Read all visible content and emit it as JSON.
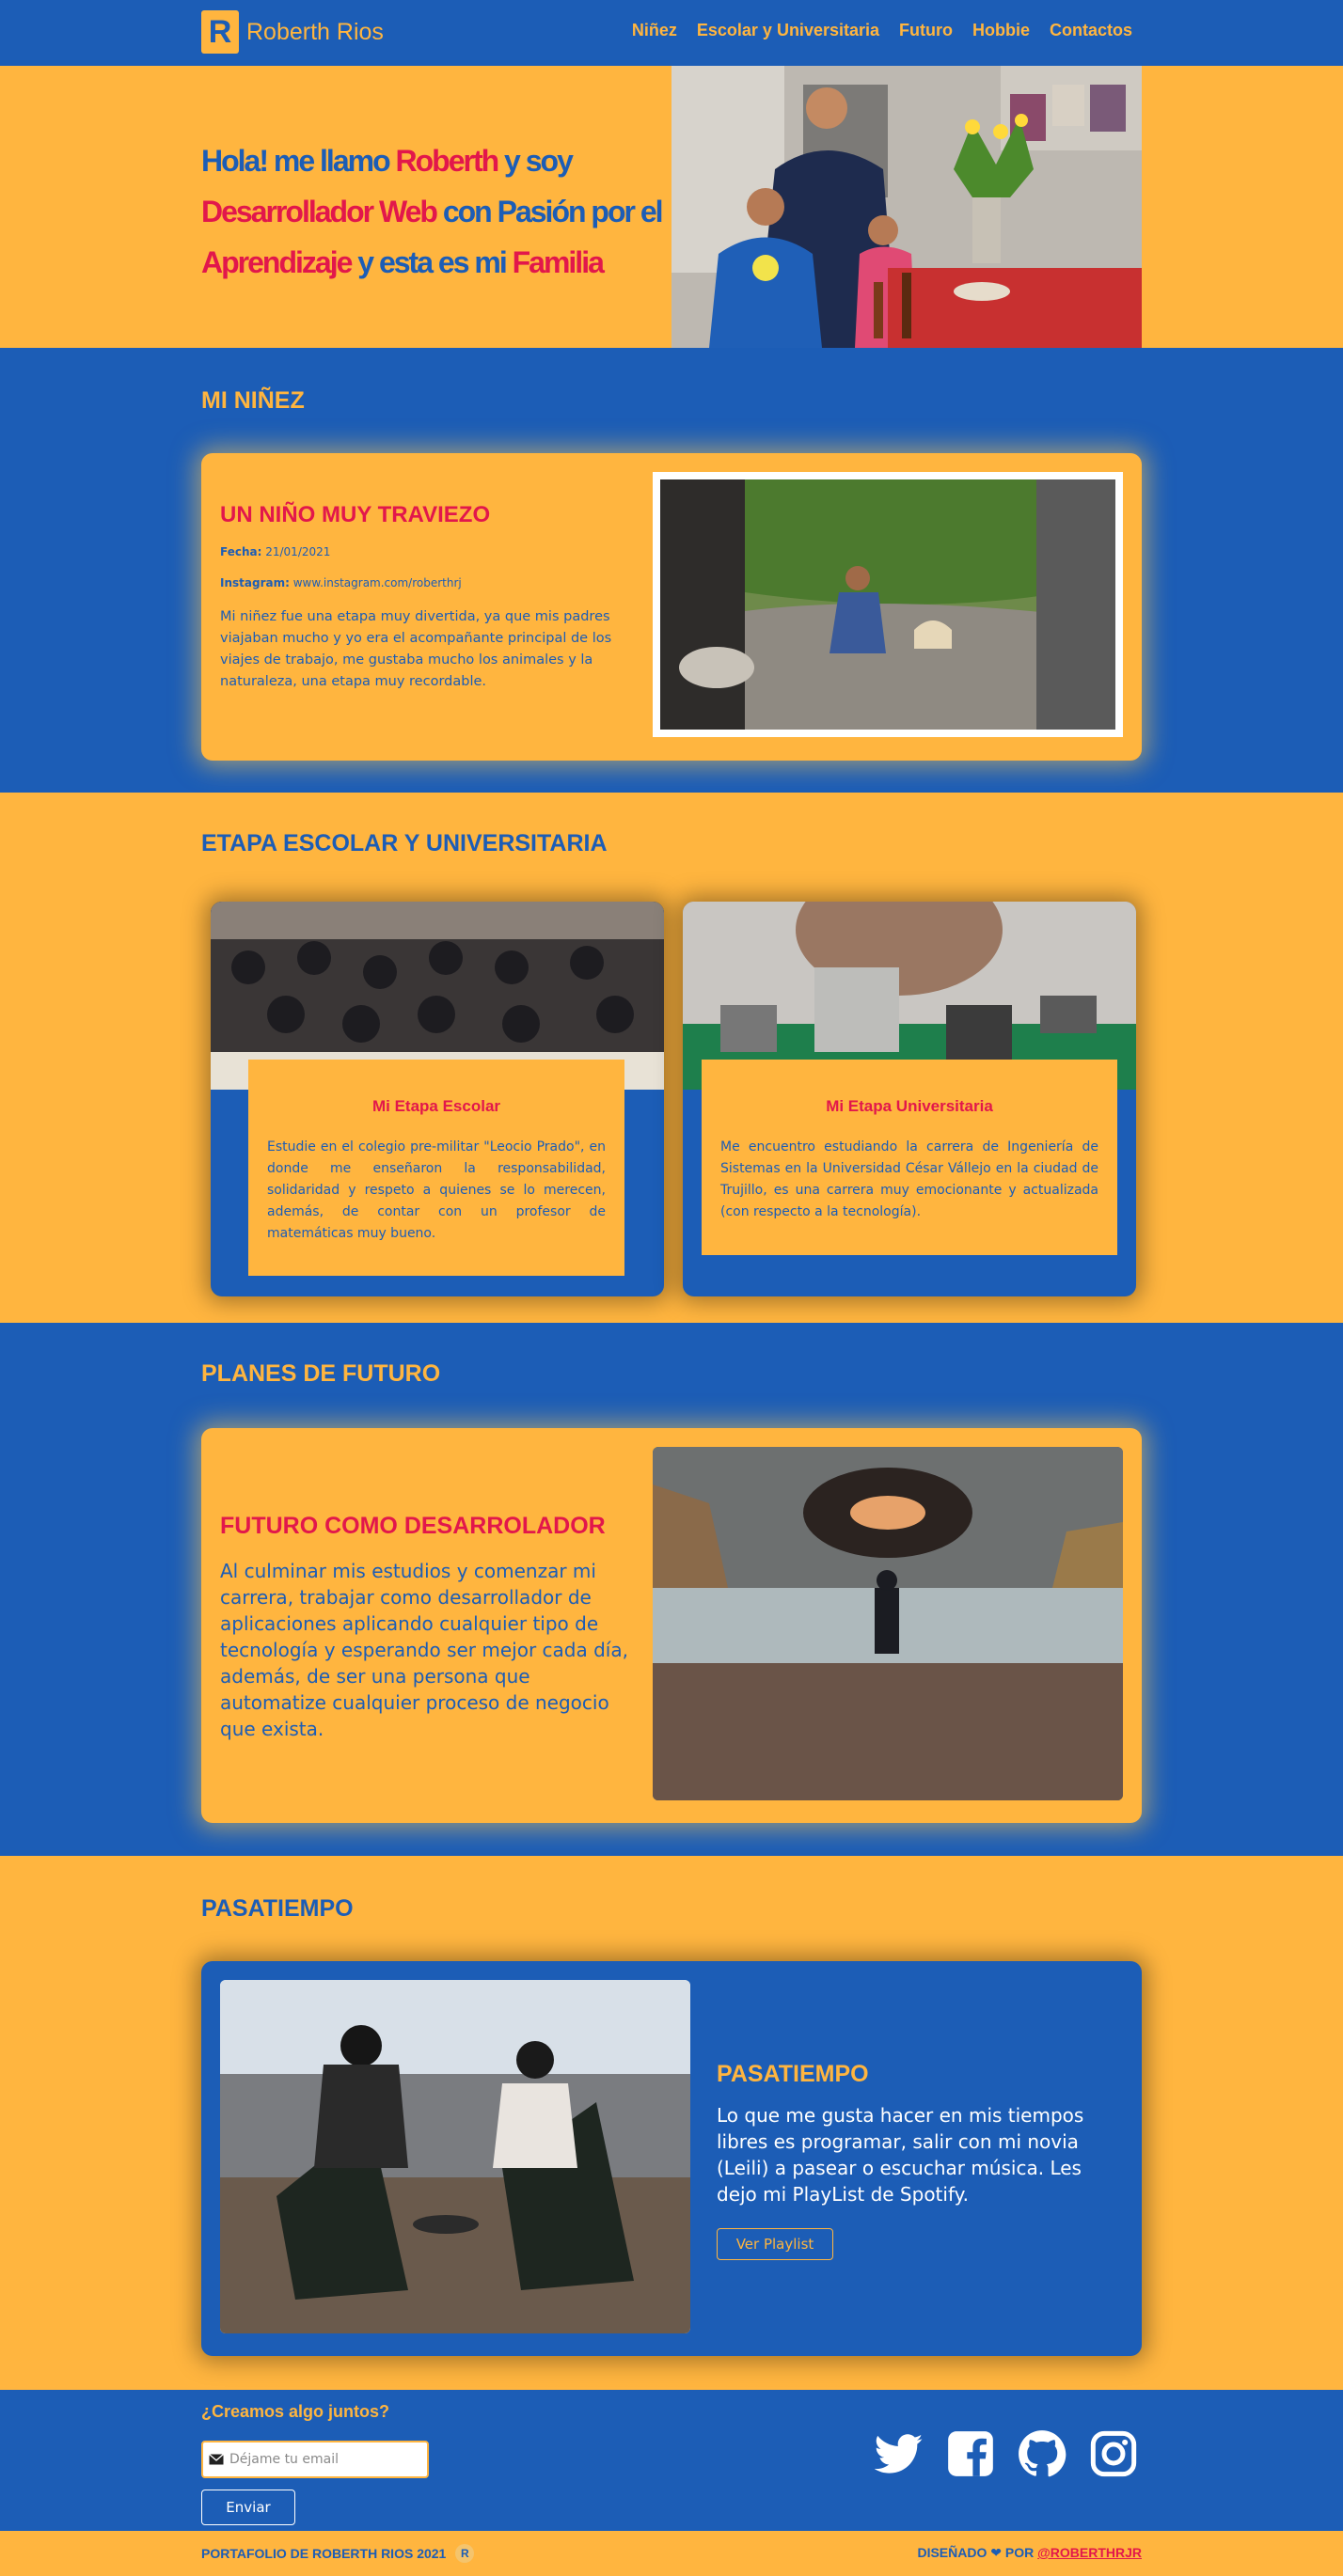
{
  "nav": {
    "brand_letter": "R",
    "brand_name": "Roberth Rios",
    "links": [
      "Niñez",
      "Escolar y Universitaria",
      "Futuro",
      "Hobbie",
      "Contactos"
    ]
  },
  "hero": {
    "t1": "Hola! me llamo ",
    "t2": "Roberth",
    "t3": " y soy ",
    "t4": "Desarrollador Web",
    "t5": " con Pasión por el ",
    "t6": "Aprendizaje",
    "t7": " y esta es mi ",
    "t8": "Familia"
  },
  "ninez": {
    "section_title": "MI NIÑEZ",
    "card_title": "UN NIÑO MUY TRAVIEZO",
    "fecha_label": "Fecha:",
    "fecha_value": "21/01/2021",
    "instagram_label": "Instagram:",
    "instagram_value": "www.instagram.com/roberthrj",
    "text": "Mi niñez fue una etapa muy divertida, ya que mis padres viajaban mucho y yo era el acompañante principal de los viajes de trabajo, me gustaba mucho los animales y la naturaleza, una etapa muy recordable."
  },
  "escolar": {
    "section_title": "ETAPA ESCOLAR Y UNIVERSITARIA",
    "cards": [
      {
        "title": "Mi Etapa Escolar",
        "text": "Estudie en el colegio pre-militar \"Leocio Prado\", en donde me enseñaron la responsabilidad, solidaridad y respeto a quienes se lo merecen, además, de contar con un profesor de matemáticas muy bueno."
      },
      {
        "title": "Mi Etapa Universitaria",
        "text": "Me encuentro estudiando la carrera de Ingeniería de Sistemas en la Universidad César Vállejo en la ciudad de Trujillo, es una carrera muy emocionante y actualizada (con respecto a la tecnología)."
      }
    ]
  },
  "futuro": {
    "section_title": "PLANES DE FUTURO",
    "card_title": "FUTURO COMO DESARROLADOR",
    "text": "Al culminar mis estudios y comenzar mi carrera, trabajar como desarrollador de aplicaciones aplicando cualquier tipo de tecnología y esperando ser mejor cada día, además, de ser una persona que automatize cualquier proceso de negocio que exista."
  },
  "pasatiempo": {
    "section_title": "PASATIEMPO",
    "card_title": "PASATIEMPO",
    "text": "Lo que me gusta hacer en mis tiempos libres es programar, salir con mi novia (Leili) a pasear o escuchar música. Les dejo mi PlayList de Spotify.",
    "button": "Ver Playlist"
  },
  "contacto": {
    "title": "¿Creamos algo juntos?",
    "email_placeholder": "Déjame tu email",
    "send_button": "Enviar"
  },
  "social_icons": [
    "twitter-icon",
    "facebook-icon",
    "github-icon",
    "instagram-icon"
  ],
  "footer": {
    "left": "PORTAFOLIO DE ROBERTH RIOS 2021",
    "logo_letter": "R",
    "right_prefix": "DISEÑADO ❤ POR ",
    "right_link": "@ROBERTHRJR"
  },
  "colors": {
    "blue": "#1c5db6",
    "yellow": "#ffb53f",
    "red": "#e2174b"
  }
}
